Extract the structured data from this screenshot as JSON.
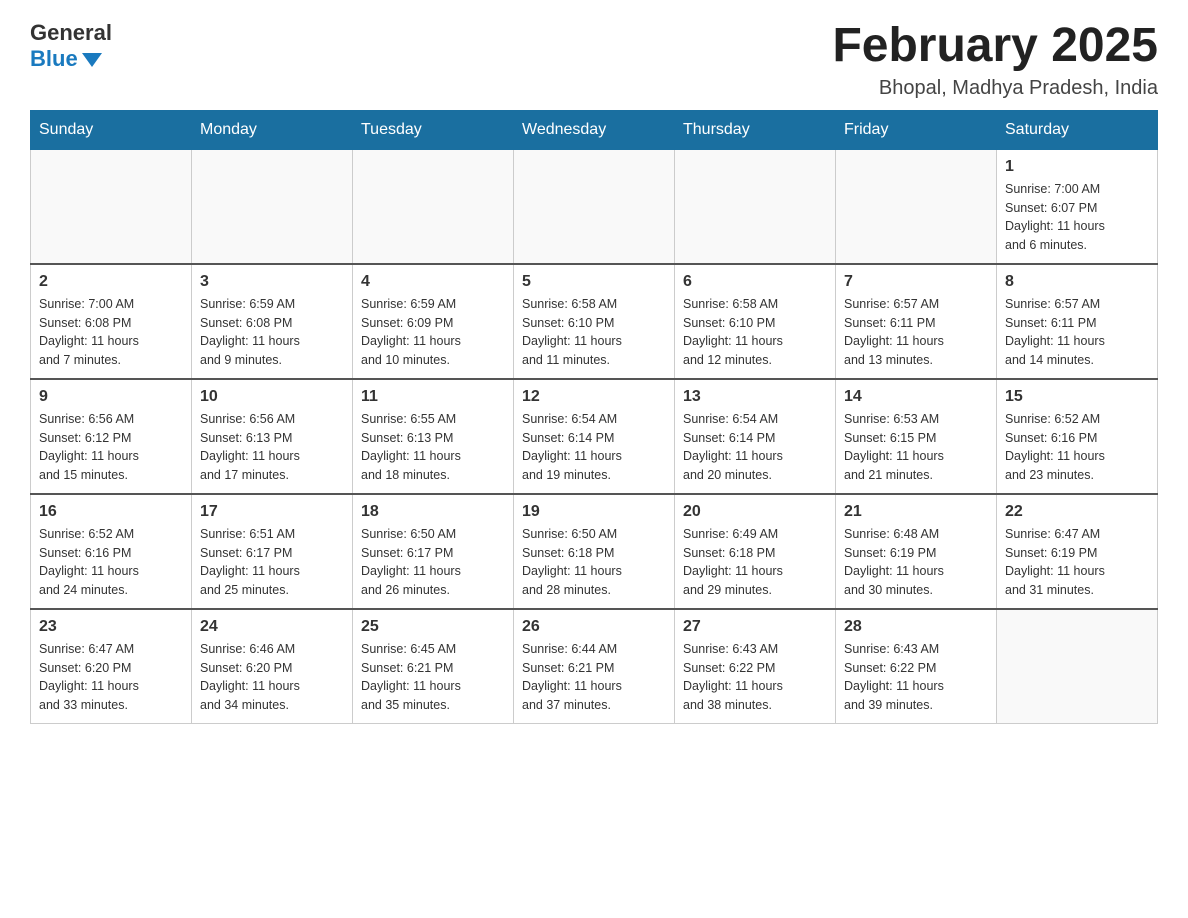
{
  "header": {
    "logo_general": "General",
    "logo_blue": "Blue",
    "month_title": "February 2025",
    "location": "Bhopal, Madhya Pradesh, India"
  },
  "days_of_week": [
    "Sunday",
    "Monday",
    "Tuesday",
    "Wednesday",
    "Thursday",
    "Friday",
    "Saturday"
  ],
  "weeks": [
    [
      {
        "day": "",
        "info": ""
      },
      {
        "day": "",
        "info": ""
      },
      {
        "day": "",
        "info": ""
      },
      {
        "day": "",
        "info": ""
      },
      {
        "day": "",
        "info": ""
      },
      {
        "day": "",
        "info": ""
      },
      {
        "day": "1",
        "info": "Sunrise: 7:00 AM\nSunset: 6:07 PM\nDaylight: 11 hours\nand 6 minutes."
      }
    ],
    [
      {
        "day": "2",
        "info": "Sunrise: 7:00 AM\nSunset: 6:08 PM\nDaylight: 11 hours\nand 7 minutes."
      },
      {
        "day": "3",
        "info": "Sunrise: 6:59 AM\nSunset: 6:08 PM\nDaylight: 11 hours\nand 9 minutes."
      },
      {
        "day": "4",
        "info": "Sunrise: 6:59 AM\nSunset: 6:09 PM\nDaylight: 11 hours\nand 10 minutes."
      },
      {
        "day": "5",
        "info": "Sunrise: 6:58 AM\nSunset: 6:10 PM\nDaylight: 11 hours\nand 11 minutes."
      },
      {
        "day": "6",
        "info": "Sunrise: 6:58 AM\nSunset: 6:10 PM\nDaylight: 11 hours\nand 12 minutes."
      },
      {
        "day": "7",
        "info": "Sunrise: 6:57 AM\nSunset: 6:11 PM\nDaylight: 11 hours\nand 13 minutes."
      },
      {
        "day": "8",
        "info": "Sunrise: 6:57 AM\nSunset: 6:11 PM\nDaylight: 11 hours\nand 14 minutes."
      }
    ],
    [
      {
        "day": "9",
        "info": "Sunrise: 6:56 AM\nSunset: 6:12 PM\nDaylight: 11 hours\nand 15 minutes."
      },
      {
        "day": "10",
        "info": "Sunrise: 6:56 AM\nSunset: 6:13 PM\nDaylight: 11 hours\nand 17 minutes."
      },
      {
        "day": "11",
        "info": "Sunrise: 6:55 AM\nSunset: 6:13 PM\nDaylight: 11 hours\nand 18 minutes."
      },
      {
        "day": "12",
        "info": "Sunrise: 6:54 AM\nSunset: 6:14 PM\nDaylight: 11 hours\nand 19 minutes."
      },
      {
        "day": "13",
        "info": "Sunrise: 6:54 AM\nSunset: 6:14 PM\nDaylight: 11 hours\nand 20 minutes."
      },
      {
        "day": "14",
        "info": "Sunrise: 6:53 AM\nSunset: 6:15 PM\nDaylight: 11 hours\nand 21 minutes."
      },
      {
        "day": "15",
        "info": "Sunrise: 6:52 AM\nSunset: 6:16 PM\nDaylight: 11 hours\nand 23 minutes."
      }
    ],
    [
      {
        "day": "16",
        "info": "Sunrise: 6:52 AM\nSunset: 6:16 PM\nDaylight: 11 hours\nand 24 minutes."
      },
      {
        "day": "17",
        "info": "Sunrise: 6:51 AM\nSunset: 6:17 PM\nDaylight: 11 hours\nand 25 minutes."
      },
      {
        "day": "18",
        "info": "Sunrise: 6:50 AM\nSunset: 6:17 PM\nDaylight: 11 hours\nand 26 minutes."
      },
      {
        "day": "19",
        "info": "Sunrise: 6:50 AM\nSunset: 6:18 PM\nDaylight: 11 hours\nand 28 minutes."
      },
      {
        "day": "20",
        "info": "Sunrise: 6:49 AM\nSunset: 6:18 PM\nDaylight: 11 hours\nand 29 minutes."
      },
      {
        "day": "21",
        "info": "Sunrise: 6:48 AM\nSunset: 6:19 PM\nDaylight: 11 hours\nand 30 minutes."
      },
      {
        "day": "22",
        "info": "Sunrise: 6:47 AM\nSunset: 6:19 PM\nDaylight: 11 hours\nand 31 minutes."
      }
    ],
    [
      {
        "day": "23",
        "info": "Sunrise: 6:47 AM\nSunset: 6:20 PM\nDaylight: 11 hours\nand 33 minutes."
      },
      {
        "day": "24",
        "info": "Sunrise: 6:46 AM\nSunset: 6:20 PM\nDaylight: 11 hours\nand 34 minutes."
      },
      {
        "day": "25",
        "info": "Sunrise: 6:45 AM\nSunset: 6:21 PM\nDaylight: 11 hours\nand 35 minutes."
      },
      {
        "day": "26",
        "info": "Sunrise: 6:44 AM\nSunset: 6:21 PM\nDaylight: 11 hours\nand 37 minutes."
      },
      {
        "day": "27",
        "info": "Sunrise: 6:43 AM\nSunset: 6:22 PM\nDaylight: 11 hours\nand 38 minutes."
      },
      {
        "day": "28",
        "info": "Sunrise: 6:43 AM\nSunset: 6:22 PM\nDaylight: 11 hours\nand 39 minutes."
      },
      {
        "day": "",
        "info": ""
      }
    ]
  ]
}
